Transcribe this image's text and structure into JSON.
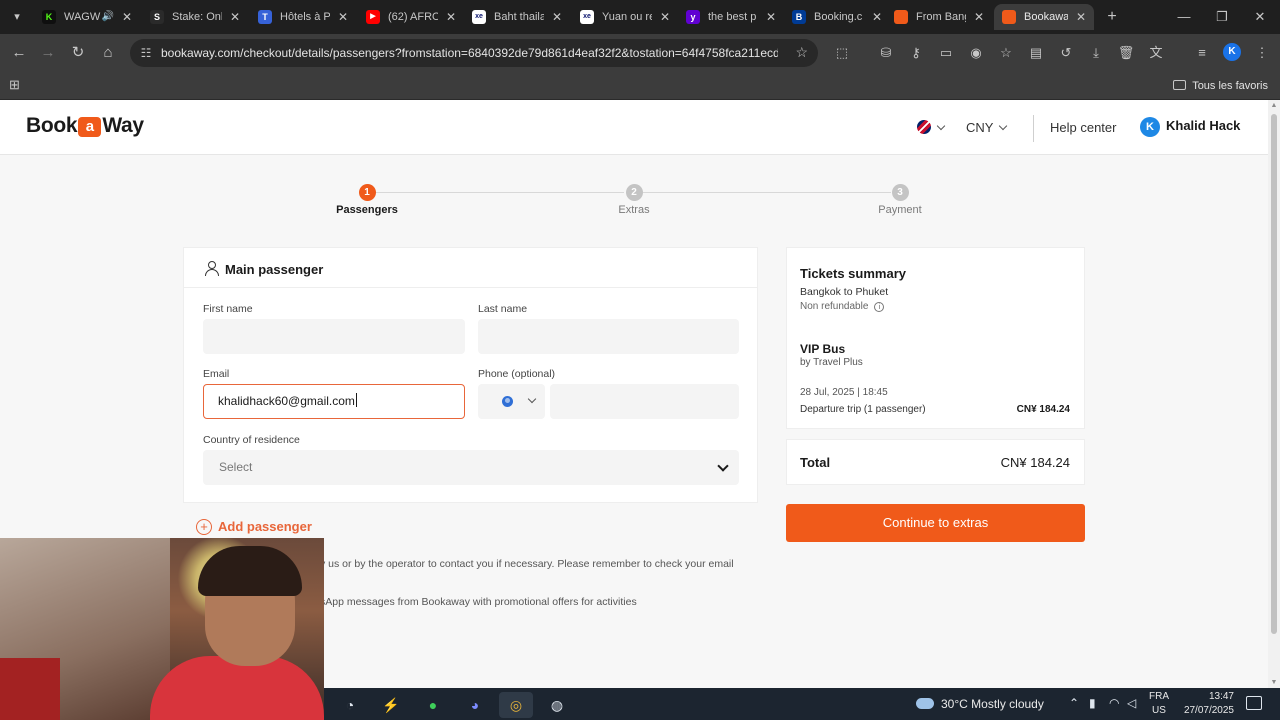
{
  "browser": {
    "tabs": [
      {
        "label": "WAGW",
        "favicon": "K",
        "favicon_color": "#53fc18"
      },
      {
        "label": "Stake: Onli",
        "favicon": "S",
        "favicon_color": "#3a3a3a"
      },
      {
        "label": "Hôtels à P",
        "favicon": "T",
        "favicon_color": "#3662d8"
      },
      {
        "label": "(62) AFRO",
        "favicon": "▶",
        "favicon_color": "#ff0000"
      },
      {
        "label": "Baht thaila",
        "favicon": "xe",
        "favicon_color": "#0a146e"
      },
      {
        "label": "Yuan ou re",
        "favicon": "xe",
        "favicon_color": "#0a146e"
      },
      {
        "label": "the best p",
        "favicon": "y",
        "favicon_color": "#6001d2"
      },
      {
        "label": "Booking.c",
        "favicon": "B",
        "favicon_color": "#003b95"
      },
      {
        "label": "From Bang",
        "favicon": "",
        "favicon_color": "#f05a1a"
      },
      {
        "label": "Bookaway",
        "favicon": "",
        "favicon_color": "#f05a1a"
      }
    ],
    "url": "bookaway.com/checkout/details/passengers?fromstation=6840392de79d861d4eaf32f2&tostation=64f4758fca211ecd5...",
    "profile_initial": "K",
    "all_bookmarks_label": "Tous les favoris"
  },
  "site": {
    "logo_left": "Book",
    "logo_mid": "a",
    "logo_right": "Way",
    "currency": "CNY",
    "help_label": "Help center",
    "user_initial": "K",
    "user_name": "Khalid Hack",
    "accent_color": "#f05a1a"
  },
  "steps": [
    {
      "num": "1",
      "label": "Passengers"
    },
    {
      "num": "2",
      "label": "Extras"
    },
    {
      "num": "3",
      "label": "Payment"
    }
  ],
  "passenger_form": {
    "title": "Main passenger",
    "first_name_label": "First name",
    "first_name_value": "",
    "last_name_label": "Last name",
    "last_name_value": "",
    "email_label": "Email",
    "email_value": "khalidhack60@gmail.com",
    "phone_label": "Phone (optional)",
    "phone_value": "",
    "country_label": "Country of residence",
    "country_value": "Select",
    "add_passenger_label": "Add passenger",
    "consent_line_1": "y us or by the operator to contact you if necessary. Please remember to check your email",
    "consent_line_2": "sApp messages from Bookaway with promotional offers for activities"
  },
  "summary": {
    "title": "Tickets summary",
    "route": "Bangkok to Phuket",
    "refund": "Non refundable",
    "vehicle": "VIP Bus",
    "operator": "by Travel Plus",
    "datetime": "28 Jul, 2025 | 18:45",
    "trip": "Departure trip (1 passenger)",
    "trip_price": "CN¥ 184.24",
    "total_label": "Total",
    "total_value": "CN¥ 184.24",
    "continue_label": "Continue to extras"
  },
  "taskbar": {
    "weather": "30°C  Mostly cloudy",
    "lang_line_1": "FRA",
    "lang_line_2": "US",
    "time": "13:47",
    "date": "27/07/2025"
  }
}
